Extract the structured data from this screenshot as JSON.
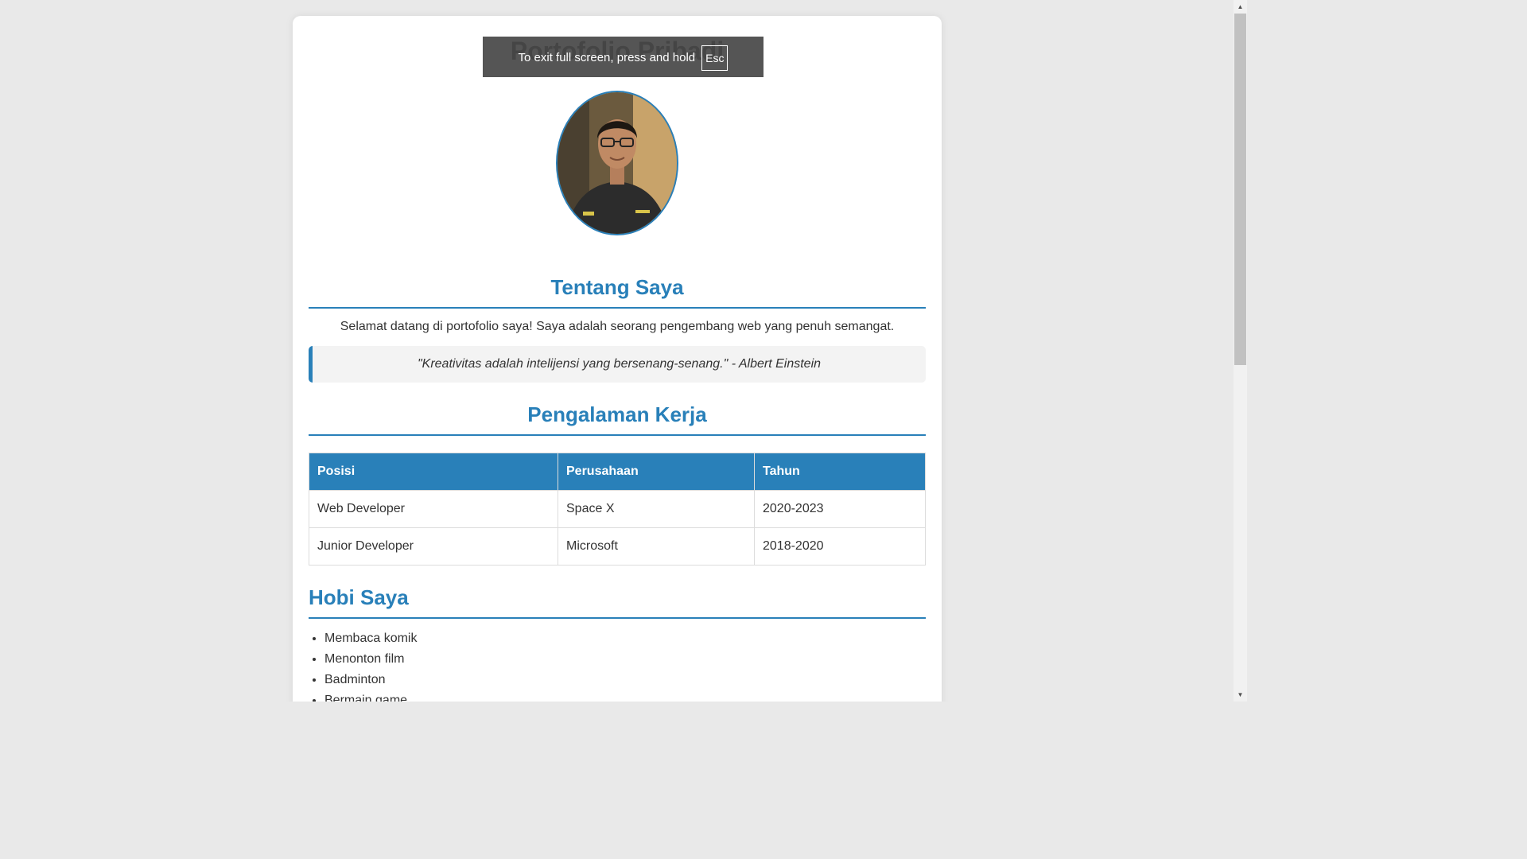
{
  "page": {
    "title": "Portofolio Pribadi"
  },
  "fullscreen_notice": {
    "text": "To exit full screen, press and hold",
    "key": "Esc"
  },
  "about": {
    "heading": "Tentang Saya",
    "intro": "Selamat datang di portofolio saya! Saya adalah seorang pengembang web yang penuh semangat.",
    "quote": "\"Kreativitas adalah intelijensi yang bersenang-senang.\" - Albert Einstein"
  },
  "experience": {
    "heading": "Pengalaman Kerja",
    "columns": [
      "Posisi",
      "Perusahaan",
      "Tahun"
    ],
    "rows": [
      [
        "Web Developer",
        "Space X",
        "2020-2023"
      ],
      [
        "Junior Developer",
        "Microsoft",
        "2018-2020"
      ]
    ]
  },
  "hobbies": {
    "heading": "Hobi Saya",
    "items": [
      "Membaca komik",
      "Menonton film",
      "Badminton",
      "Bermain game"
    ]
  },
  "colors": {
    "accent": "#2980b9",
    "page_background": "#e9e9e9",
    "card_background": "#ffffff"
  }
}
